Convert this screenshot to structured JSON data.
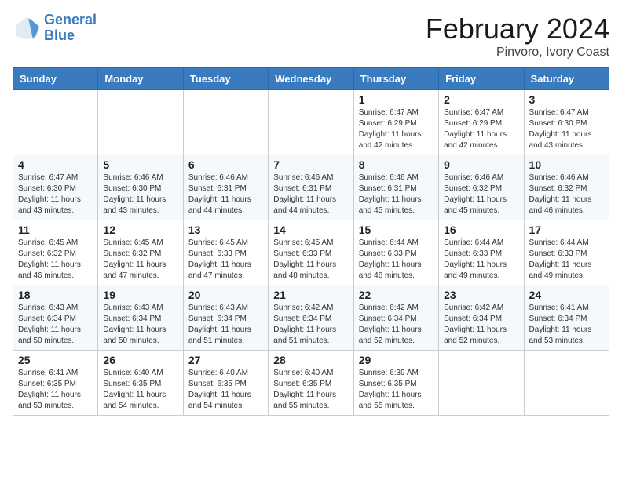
{
  "header": {
    "logo_line1": "General",
    "logo_line2": "Blue",
    "month": "February 2024",
    "location": "Pinvoro, Ivory Coast"
  },
  "days_of_week": [
    "Sunday",
    "Monday",
    "Tuesday",
    "Wednesday",
    "Thursday",
    "Friday",
    "Saturday"
  ],
  "weeks": [
    [
      {
        "day": "",
        "info": ""
      },
      {
        "day": "",
        "info": ""
      },
      {
        "day": "",
        "info": ""
      },
      {
        "day": "",
        "info": ""
      },
      {
        "day": "1",
        "info": "Sunrise: 6:47 AM\nSunset: 6:29 PM\nDaylight: 11 hours and 42 minutes."
      },
      {
        "day": "2",
        "info": "Sunrise: 6:47 AM\nSunset: 6:29 PM\nDaylight: 11 hours and 42 minutes."
      },
      {
        "day": "3",
        "info": "Sunrise: 6:47 AM\nSunset: 6:30 PM\nDaylight: 11 hours and 43 minutes."
      }
    ],
    [
      {
        "day": "4",
        "info": "Sunrise: 6:47 AM\nSunset: 6:30 PM\nDaylight: 11 hours and 43 minutes."
      },
      {
        "day": "5",
        "info": "Sunrise: 6:46 AM\nSunset: 6:30 PM\nDaylight: 11 hours and 43 minutes."
      },
      {
        "day": "6",
        "info": "Sunrise: 6:46 AM\nSunset: 6:31 PM\nDaylight: 11 hours and 44 minutes."
      },
      {
        "day": "7",
        "info": "Sunrise: 6:46 AM\nSunset: 6:31 PM\nDaylight: 11 hours and 44 minutes."
      },
      {
        "day": "8",
        "info": "Sunrise: 6:46 AM\nSunset: 6:31 PM\nDaylight: 11 hours and 45 minutes."
      },
      {
        "day": "9",
        "info": "Sunrise: 6:46 AM\nSunset: 6:32 PM\nDaylight: 11 hours and 45 minutes."
      },
      {
        "day": "10",
        "info": "Sunrise: 6:46 AM\nSunset: 6:32 PM\nDaylight: 11 hours and 46 minutes."
      }
    ],
    [
      {
        "day": "11",
        "info": "Sunrise: 6:45 AM\nSunset: 6:32 PM\nDaylight: 11 hours and 46 minutes."
      },
      {
        "day": "12",
        "info": "Sunrise: 6:45 AM\nSunset: 6:32 PM\nDaylight: 11 hours and 47 minutes."
      },
      {
        "day": "13",
        "info": "Sunrise: 6:45 AM\nSunset: 6:33 PM\nDaylight: 11 hours and 47 minutes."
      },
      {
        "day": "14",
        "info": "Sunrise: 6:45 AM\nSunset: 6:33 PM\nDaylight: 11 hours and 48 minutes."
      },
      {
        "day": "15",
        "info": "Sunrise: 6:44 AM\nSunset: 6:33 PM\nDaylight: 11 hours and 48 minutes."
      },
      {
        "day": "16",
        "info": "Sunrise: 6:44 AM\nSunset: 6:33 PM\nDaylight: 11 hours and 49 minutes."
      },
      {
        "day": "17",
        "info": "Sunrise: 6:44 AM\nSunset: 6:33 PM\nDaylight: 11 hours and 49 minutes."
      }
    ],
    [
      {
        "day": "18",
        "info": "Sunrise: 6:43 AM\nSunset: 6:34 PM\nDaylight: 11 hours and 50 minutes."
      },
      {
        "day": "19",
        "info": "Sunrise: 6:43 AM\nSunset: 6:34 PM\nDaylight: 11 hours and 50 minutes."
      },
      {
        "day": "20",
        "info": "Sunrise: 6:43 AM\nSunset: 6:34 PM\nDaylight: 11 hours and 51 minutes."
      },
      {
        "day": "21",
        "info": "Sunrise: 6:42 AM\nSunset: 6:34 PM\nDaylight: 11 hours and 51 minutes."
      },
      {
        "day": "22",
        "info": "Sunrise: 6:42 AM\nSunset: 6:34 PM\nDaylight: 11 hours and 52 minutes."
      },
      {
        "day": "23",
        "info": "Sunrise: 6:42 AM\nSunset: 6:34 PM\nDaylight: 11 hours and 52 minutes."
      },
      {
        "day": "24",
        "info": "Sunrise: 6:41 AM\nSunset: 6:34 PM\nDaylight: 11 hours and 53 minutes."
      }
    ],
    [
      {
        "day": "25",
        "info": "Sunrise: 6:41 AM\nSunset: 6:35 PM\nDaylight: 11 hours and 53 minutes."
      },
      {
        "day": "26",
        "info": "Sunrise: 6:40 AM\nSunset: 6:35 PM\nDaylight: 11 hours and 54 minutes."
      },
      {
        "day": "27",
        "info": "Sunrise: 6:40 AM\nSunset: 6:35 PM\nDaylight: 11 hours and 54 minutes."
      },
      {
        "day": "28",
        "info": "Sunrise: 6:40 AM\nSunset: 6:35 PM\nDaylight: 11 hours and 55 minutes."
      },
      {
        "day": "29",
        "info": "Sunrise: 6:39 AM\nSunset: 6:35 PM\nDaylight: 11 hours and 55 minutes."
      },
      {
        "day": "",
        "info": ""
      },
      {
        "day": "",
        "info": ""
      }
    ]
  ]
}
